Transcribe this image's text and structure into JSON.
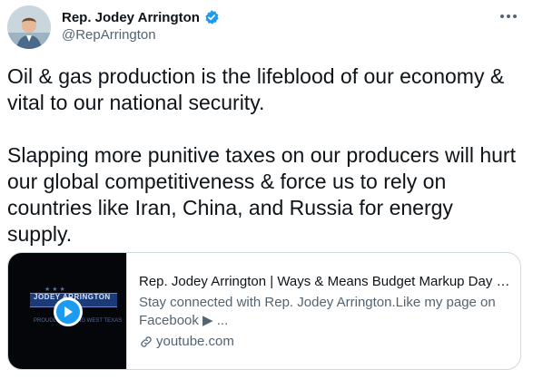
{
  "author": {
    "display_name": "Rep. Jodey Arrington",
    "handle": "@RepArrington",
    "verified_icon": "verified-badge-icon",
    "accent_color": "#1d9bf0"
  },
  "tweet": {
    "paragraph_1": "Oil & gas production is the lifeblood of our economy & vital to our national security.",
    "paragraph_2": "Slapping more punitive taxes on our producers will hurt our global competitiveness & force us to rely on countries like Iran, China, and Russia for energy supply."
  },
  "card": {
    "title": "Rep. Jodey Arrington | Ways & Means Budget Markup Day 4...",
    "description": "Stay connected with Rep. Jodey Arrington.Like my page on Facebook ▶ ...",
    "domain": "youtube.com",
    "thumbnail": {
      "banner_text": "JODEY ARRINGTON",
      "sub_text": "PROUDLY SERVING WEST TEXAS"
    }
  },
  "icons": {
    "more": "more-options-icon",
    "play": "play-icon",
    "link": "link-icon"
  }
}
